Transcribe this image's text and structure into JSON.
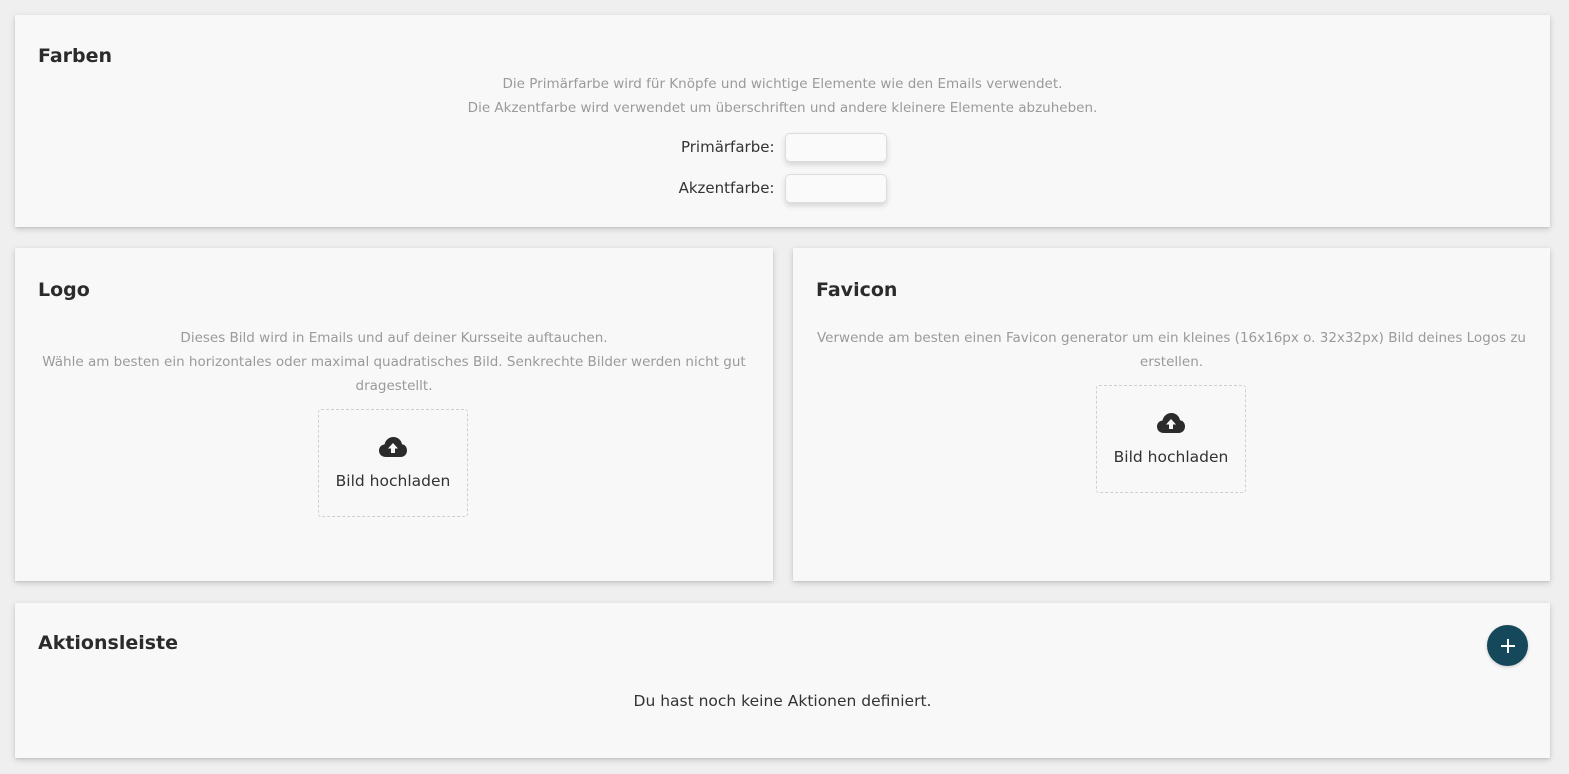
{
  "colors_card": {
    "title": "Farben",
    "description_lines": [
      "Die Primärfarbe wird für Knöpfe und wichtige Elemente wie den Emails verwendet.",
      "Die Akzentfarbe wird verwendet um überschriften und andere kleinere Elemente abzuheben."
    ],
    "primary_label": "Primärfarbe:",
    "accent_label": "Akzentfarbe:",
    "primary_value": "#fafafa",
    "accent_value": "#fafafa"
  },
  "logo_card": {
    "title": "Logo",
    "description_lines": [
      "Dieses Bild wird in Emails und auf deiner Kursseite auftauchen.",
      "Wähle am besten ein horizontales oder maximal quadratisches Bild. Senkrechte Bilder werden nicht gut",
      "dragestellt."
    ],
    "upload_label": "Bild hochladen",
    "upload_icon": "cloud-upload-icon"
  },
  "favicon_card": {
    "title": "Favicon",
    "description_lines": [
      "Verwende am besten einen Favicon generator um ein kleines (16x16px o. 32x32px) Bild deines Logos zu",
      "erstellen."
    ],
    "upload_label": "Bild hochladen",
    "upload_icon": "cloud-upload-icon"
  },
  "actions_card": {
    "title": "Aktionsleiste",
    "empty_message": "Du hast noch keine Aktionen definiert.",
    "add_icon": "plus-icon",
    "add_button_color": "#14485a"
  }
}
